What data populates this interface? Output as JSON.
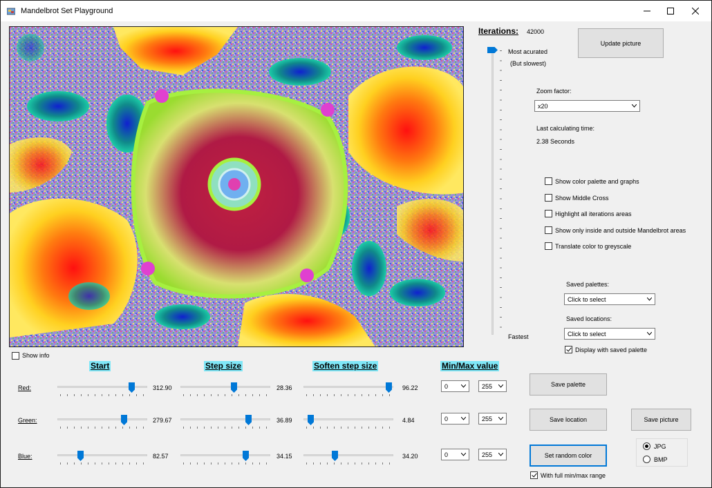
{
  "window": {
    "title": "Mandelbrot Set Playground",
    "minimize_icon": "minimize-icon",
    "maximize_icon": "maximize-icon",
    "close_icon": "close-icon"
  },
  "iterations": {
    "label": "Iterations:",
    "value": "42000",
    "most_label": "Most acurated",
    "most_sub": "(But slowest)",
    "fastest_label": "Fastest"
  },
  "update_button": "Update picture",
  "zoom": {
    "label": "Zoom factor:",
    "value": "x20"
  },
  "calc": {
    "label": "Last calculating time:",
    "value": "2.38 Seconds"
  },
  "options": [
    {
      "label": "Show color palette and graphs",
      "checked": false
    },
    {
      "label": "Show Middle Cross",
      "checked": false
    },
    {
      "label": "Highlight all iterations areas",
      "checked": false
    },
    {
      "label": "Show only inside and outside Mandelbrot areas",
      "checked": false
    },
    {
      "label": "Translate color to greyscale",
      "checked": false
    }
  ],
  "saved_palettes": {
    "label": "Saved palettes:",
    "value": "Click to select"
  },
  "saved_locations": {
    "label": "Saved locations:",
    "value": "Click to select"
  },
  "display_saved_palette": {
    "label": "Display with saved palette",
    "checked": true
  },
  "show_info": {
    "label": "Show info",
    "checked": false
  },
  "headers": {
    "start": "Start",
    "step": "Step size",
    "soften": "Soften step size",
    "minmax": "Min/Max value"
  },
  "channels": [
    {
      "name": "Red:",
      "start": "312.90",
      "step": "28.36",
      "soften": "96.22",
      "min": "0",
      "max": "255",
      "start_pos": 0.85,
      "step_pos": 0.6,
      "soften_pos": 0.98
    },
    {
      "name": "Green:",
      "start": "279.67",
      "step": "36.89",
      "soften": "4.84",
      "min": "0",
      "max": "255",
      "start_pos": 0.76,
      "step_pos": 0.78,
      "soften_pos": 0.05
    },
    {
      "name": "Blue:",
      "start": "82.57",
      "step": "34.15",
      "soften": "34.20",
      "min": "0",
      "max": "255",
      "start_pos": 0.24,
      "step_pos": 0.74,
      "soften_pos": 0.34
    }
  ],
  "buttons": {
    "save_palette": "Save  palette",
    "save_location": "Save location",
    "save_picture": "Save picture",
    "random_color": "Set random color"
  },
  "full_range": {
    "label": "With full min/max range",
    "checked": true
  },
  "format": [
    {
      "label": "JPG",
      "checked": true
    },
    {
      "label": "BMP",
      "checked": false
    }
  ],
  "iteration_slider_level": 1.0
}
